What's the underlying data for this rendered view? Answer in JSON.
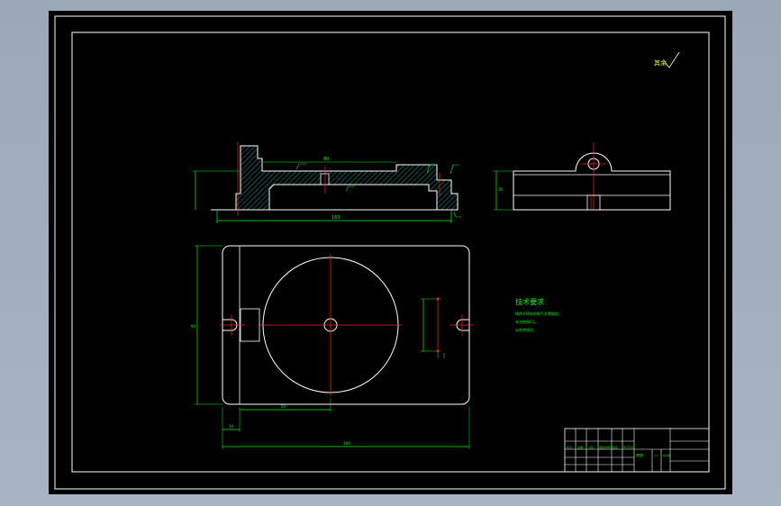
{
  "drawing": {
    "corner_note": "其余",
    "tech_req": {
      "title": "技术要求",
      "lines": [
        "铸件不得有砂眼气孔等缺陷。",
        "未注倒角C1。",
        "去毛刺锐边。"
      ]
    },
    "dims": {
      "top_width": "160",
      "top_center": "80",
      "plan_height": "90",
      "plan_width": "160",
      "plan_half": "50",
      "plan_left": "10",
      "side_height": "30"
    },
    "title_block": {
      "header_cells": [
        "标记",
        "处数",
        "分区",
        "更改文件号",
        "签名",
        "年.月.日"
      ],
      "part_name": "底座",
      "scale": "1:1",
      "sheet": "共1张"
    },
    "colors": {
      "background": "#000000",
      "frame": "#ffffff",
      "dimension": "#00ff00",
      "centerline": "#ff0000",
      "hatch": "#00ffff",
      "outline": "#ffffff"
    }
  }
}
